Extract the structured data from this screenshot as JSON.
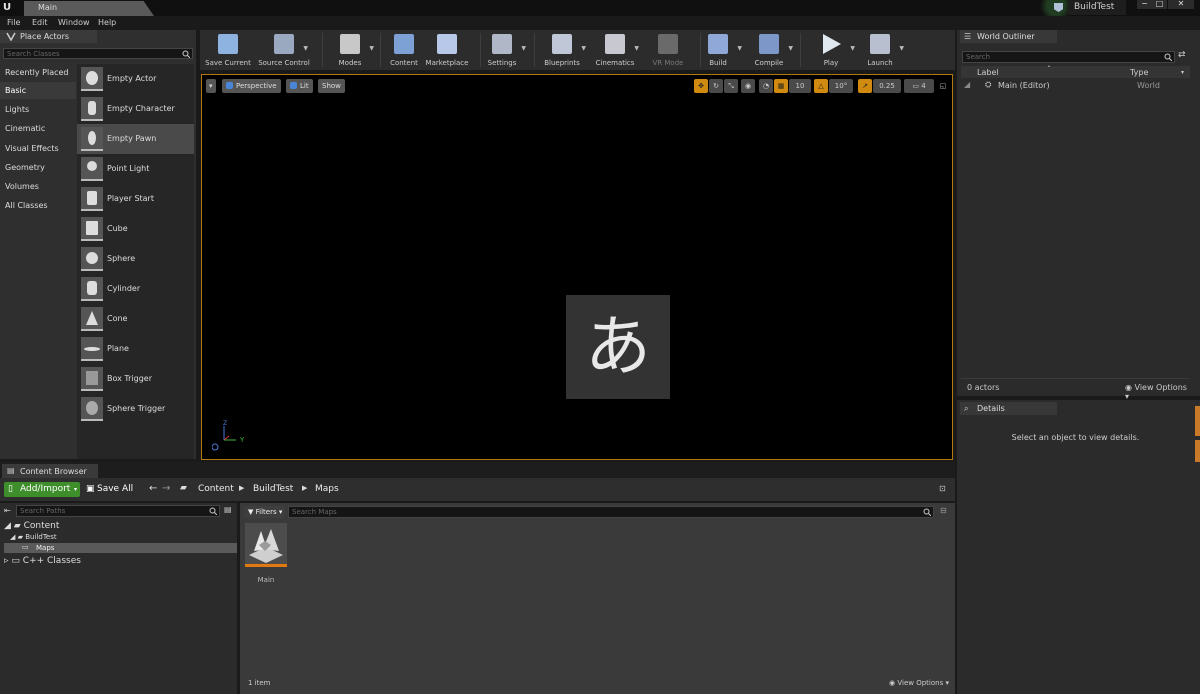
{
  "window": {
    "map_tab": "Main",
    "project_name": "BuildTest",
    "minimize": "−",
    "maximize": "□",
    "close": "✕"
  },
  "menu": [
    "File",
    "Edit",
    "Window",
    "Help"
  ],
  "place_actors": {
    "tab_label": "Place Actors",
    "search_placeholder": "Search Classes",
    "categories": [
      "Recently Placed",
      "Basic",
      "Lights",
      "Cinematic",
      "Visual Effects",
      "Geometry",
      "Volumes",
      "All Classes"
    ],
    "active_category": "Basic",
    "actors": [
      "Empty Actor",
      "Empty Character",
      "Empty Pawn",
      "Point Light",
      "Player Start",
      "Cube",
      "Sphere",
      "Cylinder",
      "Cone",
      "Plane",
      "Box Trigger",
      "Sphere Trigger"
    ],
    "selected_actor": "Empty Pawn"
  },
  "toolbar": {
    "buttons": [
      "Save Current",
      "Source Control",
      "Modes",
      "Content",
      "Marketplace",
      "Settings",
      "Blueprints",
      "Cinematics",
      "VR Mode",
      "Build",
      "Compile",
      "Play",
      "Launch"
    ]
  },
  "viewport": {
    "perspective": "Perspective",
    "lit": "Lit",
    "show": "Show",
    "grid_snap": "10",
    "rotation_snap": "10°",
    "scale_snap": "0.25",
    "camera_speed": "4",
    "ime_glyph": "あ",
    "axis_z": "Z",
    "axis_y": "Y"
  },
  "world_outliner": {
    "tab_label": "World Outliner",
    "search_placeholder": "Search",
    "col_label": "Label",
    "col_type": "Type",
    "rows": [
      {
        "label": "Main (Editor)",
        "type": "World"
      }
    ],
    "actor_count": "0 actors",
    "view_options": "View Options"
  },
  "details": {
    "tab_label": "Details",
    "empty_message": "Select an object to view details."
  },
  "content_browser": {
    "tab_label": "Content Browser",
    "add_import": "Add/Import",
    "save_all": "Save All",
    "breadcrumbs": [
      "Content",
      "BuildTest",
      "Maps"
    ],
    "path_search_placeholder": "Search Paths",
    "tree": {
      "root": "Content",
      "project": "BuildTest",
      "maps": "Maps",
      "cpp": "C++ Classes"
    },
    "filters": "Filters",
    "asset_search_placeholder": "Search Maps",
    "assets": [
      {
        "name": "Main"
      }
    ],
    "item_count": "1 item",
    "view_options": "View Options"
  },
  "colors": {
    "accent_orange": "#e07a10",
    "add_import_green": "#3f8e2c",
    "viewport_border": "#b07a10"
  }
}
